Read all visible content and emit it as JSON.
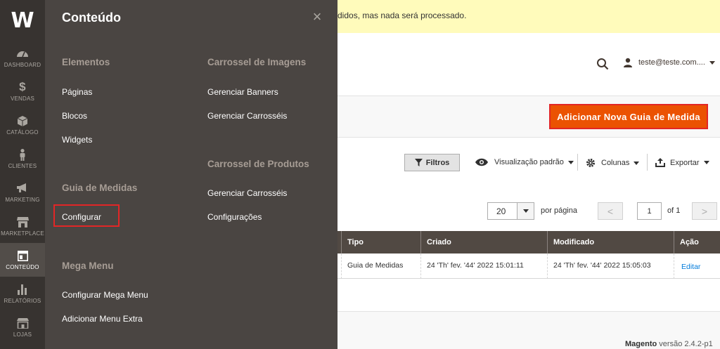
{
  "nav": {
    "logo": "W",
    "items": [
      {
        "label": "DASHBOARD"
      },
      {
        "label": "VENDAS"
      },
      {
        "label": "CATÁLOGO"
      },
      {
        "label": "CLIENTES"
      },
      {
        "label": "MARKETING"
      },
      {
        "label": "MARKETPLACE"
      },
      {
        "label": "CONTEÚDO"
      },
      {
        "label": "RELATÓRIOS"
      },
      {
        "label": "LOJAS"
      }
    ]
  },
  "flyout": {
    "title": "Conteúdo",
    "close": "×",
    "sections": {
      "elementos": {
        "title": "Elementos",
        "links": [
          "Páginas",
          "Blocos",
          "Widgets"
        ]
      },
      "guia": {
        "title": "Guia de Medidas",
        "links": [
          "Configurar"
        ]
      },
      "mega": {
        "title": "Mega Menu",
        "links": [
          "Configurar Mega Menu",
          "Adicionar Menu Extra"
        ]
      },
      "carrossel_imagens": {
        "title": "Carrossel de Imagens",
        "links": [
          "Gerenciar Banners",
          "Gerenciar Carrosséis"
        ]
      },
      "carrossel_produtos": {
        "title": "Carrossel de Produtos",
        "links": [
          "Gerenciar Carrosséis",
          "Configurações"
        ]
      }
    }
  },
  "notice": "didos, mas nada será processado.",
  "header": {
    "user": "teste@teste.com...."
  },
  "actions": {
    "add_button": "Adicionar Nova Guia de Medida"
  },
  "toolbar": {
    "filters": "Filtros",
    "view": "Visualização padrão",
    "columns": "Colunas",
    "export": "Exportar"
  },
  "pager": {
    "per_page_value": "20",
    "per_page_label": "por página",
    "page": "1",
    "of": "of 1",
    "prev": "<",
    "next": ">"
  },
  "table": {
    "headers": [
      "Tipo",
      "Criado",
      "Modificado",
      "Ação"
    ],
    "rows": [
      {
        "tipo": "Guia de Medidas",
        "criado": "24 'Th' fev. '44' 2022 15:01:11",
        "modificado": "24 'Th' fev. '44' 2022 15:05:03",
        "acao": "Editar"
      }
    ]
  },
  "footer": {
    "brand": "Magento",
    "version": " versão 2.4.2-p1"
  },
  "colors": {
    "accent": "#eb5202",
    "nav_bg": "#373330",
    "flyout_bg": "#4a4542",
    "highlight_border": "#e22626",
    "link": "#007bdb"
  }
}
